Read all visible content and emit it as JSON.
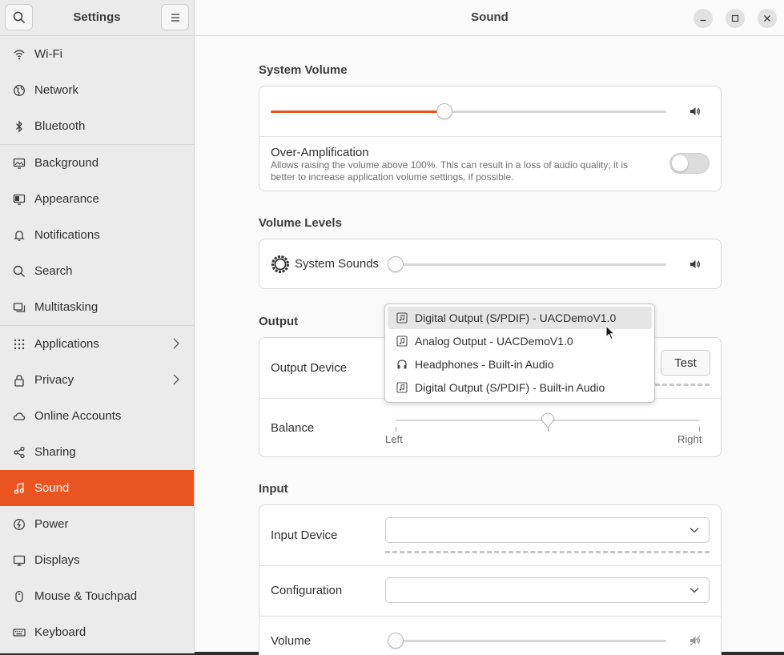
{
  "sidebar": {
    "title": "Settings",
    "items": [
      {
        "label": "Wi-Fi",
        "icon": "wifi-icon"
      },
      {
        "label": "Network",
        "icon": "network-icon"
      },
      {
        "label": "Bluetooth",
        "icon": "bluetooth-icon"
      },
      {
        "label": "Background",
        "icon": "background-icon"
      },
      {
        "label": "Appearance",
        "icon": "appearance-icon"
      },
      {
        "label": "Notifications",
        "icon": "bell-icon"
      },
      {
        "label": "Search",
        "icon": "search-icon"
      },
      {
        "label": "Multitasking",
        "icon": "multitasking-icon"
      },
      {
        "label": "Applications",
        "icon": "grid-icon"
      },
      {
        "label": "Privacy",
        "icon": "lock-icon"
      },
      {
        "label": "Online Accounts",
        "icon": "cloud-icon"
      },
      {
        "label": "Sharing",
        "icon": "share-icon"
      },
      {
        "label": "Sound",
        "icon": "music-note-icon",
        "active": true
      },
      {
        "label": "Power",
        "icon": "power-icon"
      },
      {
        "label": "Displays",
        "icon": "display-icon"
      },
      {
        "label": "Mouse & Touchpad",
        "icon": "mouse-icon"
      },
      {
        "label": "Keyboard",
        "icon": "keyboard-icon"
      }
    ]
  },
  "header": {
    "title": "Sound"
  },
  "system_volume": {
    "title": "System Volume",
    "level": 0.44,
    "over_amp_label": "Over-Amplification",
    "over_amp_desc": "Allows raising the volume above 100%. This can result in a loss of audio quality; it is better to increase application volume settings, if possible.",
    "over_amp_on": false
  },
  "volume_levels": {
    "title": "Volume Levels",
    "system_sounds_label": "System Sounds",
    "level": 0.0
  },
  "output": {
    "title": "Output",
    "device_label": "Output Device",
    "test_label": "Test",
    "balance_label": "Balance",
    "balance_left": "Left",
    "balance_right": "Right",
    "balance_value": 0.5
  },
  "input": {
    "title": "Input",
    "device_label": "Input Device",
    "configuration_label": "Configuration",
    "volume_label": "Volume",
    "level": 0.0
  },
  "dropdown": {
    "items": [
      {
        "label": "Digital Output (S/PDIF) - UACDemoV1.0",
        "icon": "music-file-icon",
        "hover": true
      },
      {
        "label": "Analog Output - UACDemoV1.0",
        "icon": "music-file-icon"
      },
      {
        "label": "Headphones - Built-in Audio",
        "icon": "headphones-icon"
      },
      {
        "label": "Digital Output (S/PDIF) - Built-in Audio",
        "icon": "music-file-icon"
      }
    ]
  },
  "colors": {
    "accent": "#e95420"
  }
}
